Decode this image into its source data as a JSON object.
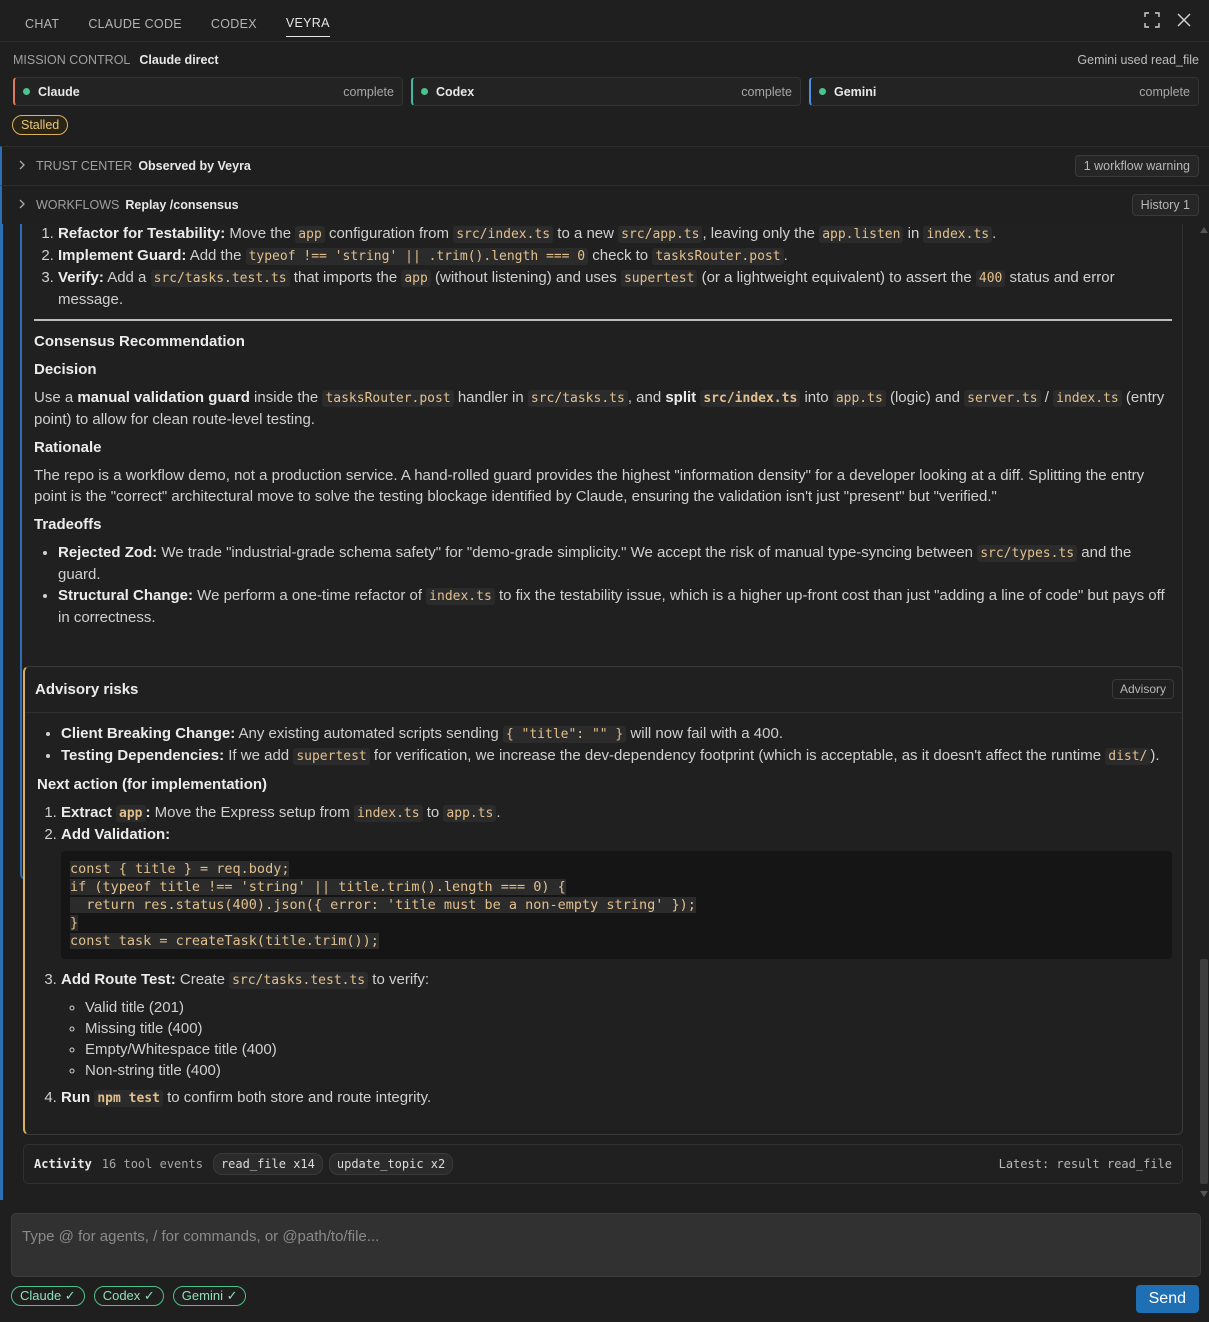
{
  "tabs": [
    "CHAT",
    "CLAUDE CODE",
    "CODEX",
    "VEYRA"
  ],
  "mission_control": {
    "label": "MISSION CONTROL",
    "title": "Claude direct",
    "status": "Gemini used read_file"
  },
  "agents": [
    {
      "name": "Claude",
      "status": "complete"
    },
    {
      "name": "Codex",
      "status": "complete"
    },
    {
      "name": "Gemini",
      "status": "complete"
    }
  ],
  "stalled": "Stalled",
  "trust": {
    "label": "TRUST CENTER",
    "value": "Observed by Veyra",
    "badge": "1 workflow warning"
  },
  "workflows": {
    "label": "WORKFLOWS",
    "value": "Replay /consensus",
    "badge": "History 1"
  },
  "card1": {
    "steps": [
      {
        "bold": "Refactor for Testability:",
        "t1": " Move the ",
        "c1": "app",
        "t2": " configuration from ",
        "c2": "src/index.ts",
        "t3": " to a new ",
        "c3": "src/app.ts",
        "t4": ", leaving only the ",
        "c4": "app.listen",
        "t5": " in ",
        "c5": "index.ts",
        "t6": "."
      },
      {
        "bold": "Implement Guard:",
        "t1": " Add the ",
        "c1": "typeof !== 'string' || .trim().length === 0",
        "t2": " check to ",
        "c2": "tasksRouter.post",
        "t3": "."
      },
      {
        "bold": "Verify:",
        "t1": " Add a ",
        "c1": "src/tasks.test.ts",
        "t2": " that imports the ",
        "c2": "app",
        "t3": " (without listening) and uses ",
        "c3": "supertest",
        "t4": " (or a lightweight equivalent) to assert the ",
        "c4": "400",
        "t5": " status and error message."
      }
    ],
    "consensus_heading": "Consensus Recommendation",
    "decision_heading": "Decision",
    "decision": {
      "t1": "Use a ",
      "b1": "manual validation guard",
      "t2": " inside the ",
      "c1": "tasksRouter.post",
      "t3": " handler in ",
      "c2": "src/tasks.ts",
      "t4": ", and ",
      "b2": "split",
      "c3": "src/index.ts",
      "t5": " into ",
      "c4": "app.ts",
      "t6": " (logic) and ",
      "c5": "server.ts",
      "t7": " / ",
      "c6": "index.ts",
      "t8": " (entry point) to allow for clean route-level testing."
    },
    "rationale_heading": "Rationale",
    "rationale": "The repo is a workflow demo, not a production service. A hand-rolled guard provides the highest \"information density\" for a developer looking at a diff. Splitting the entry point is the \"correct\" architectural move to solve the testing blockage identified by Claude, ensuring the validation isn't just \"present\" but \"verified.\"",
    "tradeoffs_heading": "Tradeoffs",
    "tradeoffs": [
      {
        "bold": "Rejected Zod:",
        "t1": " We trade \"industrial-grade schema safety\" for \"demo-grade simplicity.\" We accept the risk of manual type-syncing between ",
        "c1": "src/types.ts",
        "t2": " and the guard."
      },
      {
        "bold": "Structural Change:",
        "t1": " We perform a one-time refactor of ",
        "c1": "index.ts",
        "t2": " to fix the testability issue, which is a higher up-front cost than just \"adding a line of code\" but pays off in correctness."
      }
    ]
  },
  "card2": {
    "title": "Advisory risks",
    "badge": "Advisory",
    "risks": [
      {
        "bold": "Client Breaking Change:",
        "t1": " Any existing automated scripts sending ",
        "c1": "{ \"title\": \"\" }",
        "t2": " will now fail with a 400."
      },
      {
        "bold": "Testing Dependencies:",
        "t1": " If we add ",
        "c1": "supertest",
        "t2": " for verification, we increase the dev-dependency footprint (which is acceptable, as it doesn't affect the runtime ",
        "c2": "dist/",
        "t3": ")."
      }
    ],
    "next_heading": "Next action (for implementation)",
    "step1": {
      "bold": "Extract ",
      "c0": "app",
      "bold2": ":",
      "t1": " Move the Express setup from ",
      "c1": "index.ts",
      "t2": " to ",
      "c2": "app.ts",
      "t3": "."
    },
    "step2": {
      "bold": "Add Validation:"
    },
    "code": [
      "const { title } = req.body;",
      "if (typeof title !== 'string' || title.trim().length === 0) {",
      "  return res.status(400).json({ error: 'title must be a non-empty string' });",
      "}",
      "const task = createTask(title.trim());"
    ],
    "step3": {
      "bold": "Add Route Test:",
      "t1": " Create ",
      "c1": "src/tasks.test.ts",
      "t2": " to verify:"
    },
    "tests": [
      "Valid title (201)",
      "Missing title (400)",
      "Empty/Whitespace title (400)",
      "Non-string title (400)"
    ],
    "step4": {
      "bold": "Run ",
      "c1": "npm test",
      "t1": " to confirm both store and route integrity."
    }
  },
  "activity": {
    "title": "Activity",
    "count": "16 tool events",
    "pills": [
      "read_file x14",
      "update_topic x2"
    ],
    "latest": "Latest: result read_file"
  },
  "input": {
    "placeholder": "Type @ for agents, / for commands, or @path/to/file..."
  },
  "chips": [
    "Claude ✓",
    "Codex ✓",
    "Gemini ✓"
  ],
  "send": "Send",
  "colors": {
    "accent": "#2d6fb5",
    "warning": "#d9b15f",
    "ok": "#4cc38a",
    "code": "#e2c08d"
  }
}
